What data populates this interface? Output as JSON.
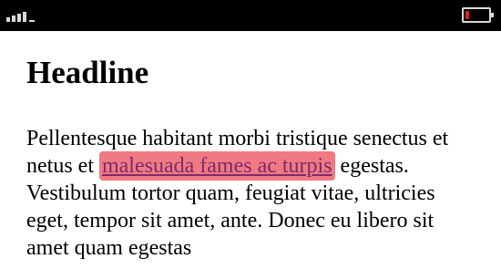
{
  "status_bar": {
    "signal_icon": "signal-strength-icon",
    "battery_icon": "battery-icon",
    "battery_level": 0.15,
    "battery_level_color": "#e02020"
  },
  "article": {
    "headline": "Headline",
    "paragraph": {
      "before_link": "Pellentesque habitant morbi tristique senectus et netus et ",
      "link_text": "malesuada fames ac turpis",
      "after_link": " egestas. Vestibulum tortor quam, feugiat vitae, ultricies eget, tempor sit amet, ante. Donec eu libero sit amet quam egestas"
    }
  },
  "colors": {
    "link_text": "#7d2a6c",
    "link_highlight": "#f07a83"
  }
}
